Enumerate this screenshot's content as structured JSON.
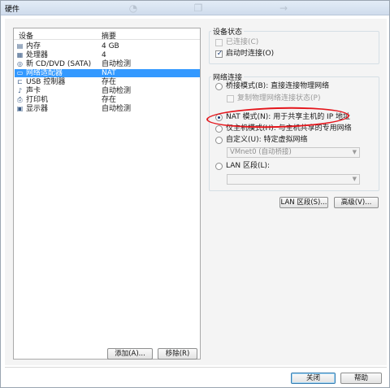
{
  "window": {
    "title": "硬件"
  },
  "device_list": {
    "headers": {
      "device": "设备",
      "summary": "摘要"
    },
    "rows": [
      {
        "icon": "memory-icon",
        "device": "内存",
        "summary": "4 GB"
      },
      {
        "icon": "processor-icon",
        "device": "处理器",
        "summary": "4"
      },
      {
        "icon": "cd-dvd-icon",
        "device": "新 CD/DVD (SATA)",
        "summary": "自动检测"
      },
      {
        "icon": "network-adapter-icon",
        "device": "网络适配器",
        "summary": "NAT",
        "selected": true
      },
      {
        "icon": "usb-icon",
        "device": "USB 控制器",
        "summary": "存在"
      },
      {
        "icon": "sound-card-icon",
        "device": "声卡",
        "summary": "自动检测"
      },
      {
        "icon": "printer-icon",
        "device": "打印机",
        "summary": "存在"
      },
      {
        "icon": "display-icon",
        "device": "显示器",
        "summary": "自动检测"
      }
    ]
  },
  "buttons": {
    "add": "添加(A)...",
    "remove": "移除(R)",
    "lan_segments": "LAN 区段(S)...",
    "advanced": "高级(V)...",
    "close": "关闭",
    "help": "帮助"
  },
  "device_status": {
    "title": "设备状态",
    "connected": {
      "label": "已连接(C)",
      "checked": false,
      "enabled": false
    },
    "connect_at_power_on": {
      "label": "启动时连接(O)",
      "checked": true,
      "enabled": true
    }
  },
  "network_connection": {
    "title": "网络连接",
    "bridged": {
      "label": "桥接模式(B): 直接连接物理网络",
      "selected": false
    },
    "replicate_state": {
      "label": "复制物理网络连接状态(P)",
      "checked": false,
      "enabled": false
    },
    "nat": {
      "label": "NAT 模式(N): 用于共享主机的 IP 地址",
      "selected": true
    },
    "host_only": {
      "label": "仅主机模式(H): 与主机共享的专用网络",
      "selected": false
    },
    "custom": {
      "label": "自定义(U): 特定虚拟网络",
      "selected": false
    },
    "custom_select_value": "VMnet0 (自动桥接)",
    "lan_segment": {
      "label": "LAN 区段(L):",
      "selected": false
    },
    "lan_segment_select_value": ""
  },
  "colors": {
    "selection": "#3399ff",
    "annotation": "#e4161c",
    "window_bg": "#f4f4f4"
  }
}
